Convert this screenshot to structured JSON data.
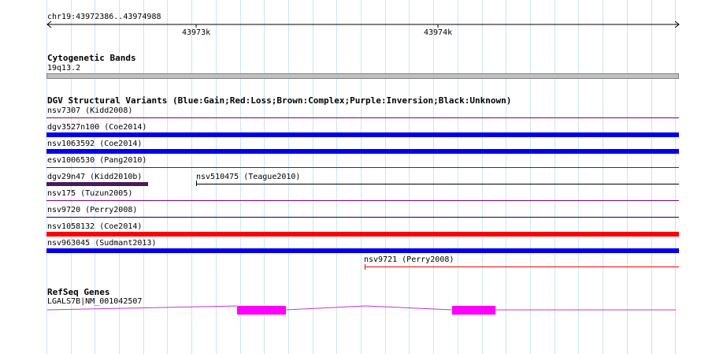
{
  "ruler": {
    "region": "chr19:43972386..43974988",
    "tick_labels": [
      "43973k",
      "43974k"
    ]
  },
  "cytoband": {
    "title": "Cytogenetic Bands",
    "label": "19q13.2",
    "color": "#c0c0c0"
  },
  "dgv": {
    "title": "DGV Structural Variants (Blue:Gain;Red:Loss;Brown:Complex;Purple:Inversion;Black:Unknown)",
    "colors": {
      "gain": "#0000ee",
      "loss": "#ff0000",
      "complex": "#5a1a1a",
      "inversion": "#800080",
      "unknown": "#000000"
    },
    "variants": [
      {
        "id": "v1",
        "label": "nsv7307 (Kidd2008)",
        "type": "inversion"
      },
      {
        "id": "v2",
        "label": "dgv3527n100 (Coe2014)",
        "type": "gain"
      },
      {
        "id": "v3",
        "label": "nsv1063592 (Coe2014)",
        "type": "gain"
      },
      {
        "id": "v4",
        "label": "esv1006530 (Pang2010)",
        "type": "inversion"
      },
      {
        "id": "v5",
        "label": "dgv29n47 (Kidd2010b)",
        "type": "complex"
      },
      {
        "id": "v6",
        "label": "nsv510475 (Teague2010)",
        "type": "unknown"
      },
      {
        "id": "v7",
        "label": "nsv175 (Tuzun2005)",
        "type": "inversion"
      },
      {
        "id": "v8",
        "label": "nsv9720 (Perry2008)",
        "type": "gain"
      },
      {
        "id": "v9",
        "label": "nsv1058132 (Coe2014)",
        "type": "loss"
      },
      {
        "id": "v10",
        "label": "nsv963045 (Sudmant2013)",
        "type": "gain"
      },
      {
        "id": "v11",
        "label": "nsv9721 (Perry2008)",
        "type": "loss"
      }
    ]
  },
  "refseq": {
    "title": "RefSeq Genes",
    "gene_label": "LGALS7B|NM_001042507",
    "color": "#ff00ff",
    "intron_color": "#cc33cc"
  }
}
